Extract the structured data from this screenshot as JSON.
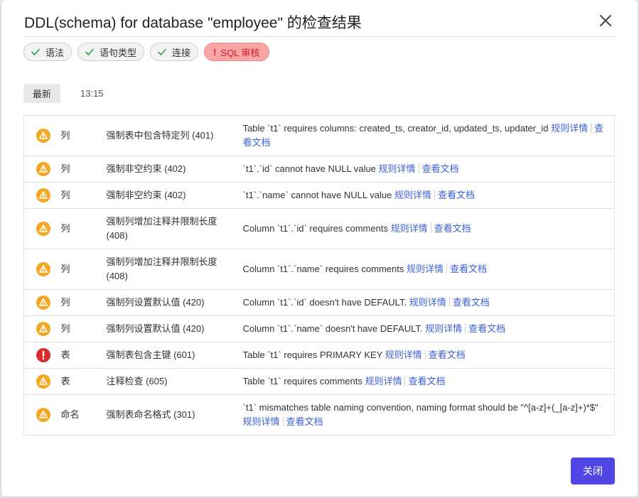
{
  "dialog": {
    "title": "DDL(schema) for database \"employee\" 的检查结果",
    "close_button": "关闭"
  },
  "chips": [
    {
      "label": "语法",
      "status": "success",
      "icon": "check-icon"
    },
    {
      "label": "语句类型",
      "status": "success",
      "icon": "check-icon"
    },
    {
      "label": "连接",
      "status": "success",
      "icon": "check-icon"
    },
    {
      "label": "SQL 审核",
      "status": "error",
      "icon": "exclamation-icon",
      "prefix": "!"
    }
  ],
  "history": {
    "latest_label": "最新",
    "time_label": "13:15"
  },
  "links": {
    "rule_details": "规则详情",
    "view_docs": "查看文档"
  },
  "rows": [
    {
      "status": "warning",
      "category": "列",
      "rule": "强制表中包含特定列 (401)",
      "message": "Table `t1` requires columns: created_ts, creator_id, updated_ts, updater_id"
    },
    {
      "status": "warning",
      "category": "列",
      "rule": "强制非空约束 (402)",
      "message": "`t1`.`id` cannot have NULL value"
    },
    {
      "status": "warning",
      "category": "列",
      "rule": "强制非空约束 (402)",
      "message": "`t1`.`name` cannot have NULL value"
    },
    {
      "status": "warning",
      "category": "列",
      "rule": "强制列增加注释并限制长度 (408)",
      "message": "Column `t1`.`id` requires comments"
    },
    {
      "status": "warning",
      "category": "列",
      "rule": "强制列增加注释并限制长度 (408)",
      "message": "Column `t1`.`name` requires comments"
    },
    {
      "status": "warning",
      "category": "列",
      "rule": "强制列设置默认值 (420)",
      "message": "Column `t1`.`id` doesn't have DEFAULT."
    },
    {
      "status": "warning",
      "category": "列",
      "rule": "强制列设置默认值 (420)",
      "message": "Column `t1`.`name` doesn't have DEFAULT."
    },
    {
      "status": "error",
      "category": "表",
      "rule": "强制表包含主键 (601)",
      "message": "Table `t1` requires PRIMARY KEY"
    },
    {
      "status": "warning",
      "category": "表",
      "rule": "注释检查 (605)",
      "message": "Table `t1` requires comments"
    },
    {
      "status": "warning",
      "category": "命名",
      "rule": "强制表命名格式 (301)",
      "message": "`t1` mismatches table naming convention, naming format should be \"^[a-z]+(_[a-z]+)*$\""
    }
  ],
  "colors": {
    "warning": "#f5a623",
    "error": "#d92b2b",
    "success": "#2e9e4f",
    "link": "#3b5fd9",
    "primary_button": "#5145e6"
  }
}
